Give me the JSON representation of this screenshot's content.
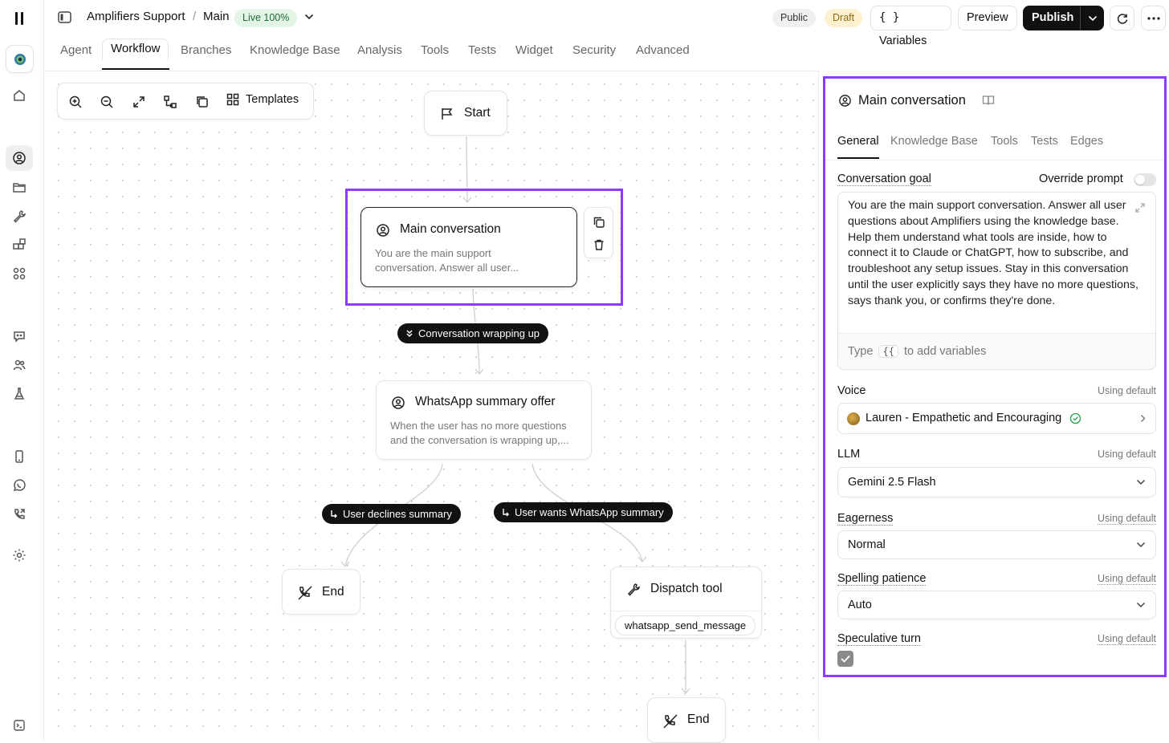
{
  "header": {
    "agent_name": "Amplifiers Support",
    "separator": "/",
    "branch": "Main",
    "live_badge": "Live 100%",
    "public_badge": "Public",
    "draft_badge": "Draft",
    "variables_label": "Variables",
    "preview_label": "Preview",
    "publish_label": "Publish"
  },
  "tabs": [
    "Agent",
    "Workflow",
    "Branches",
    "Knowledge Base",
    "Analysis",
    "Tools",
    "Tests",
    "Widget",
    "Security",
    "Advanced"
  ],
  "active_tab": "Workflow",
  "toolbar": {
    "templates_label": "Templates"
  },
  "nodes": {
    "start": {
      "title": "Start"
    },
    "main": {
      "title": "Main conversation",
      "desc_line1": "You are the main support",
      "desc_line2": "conversation. Answer all user..."
    },
    "whatsapp": {
      "title": "WhatsApp summary offer",
      "desc_line1": "When the user has no more questions",
      "desc_line2": "and the conversation is wrapping up,..."
    },
    "end1": {
      "title": "End"
    },
    "dispatch": {
      "title": "Dispatch tool",
      "tool": "whatsapp_send_message"
    },
    "end2": {
      "title": "End"
    }
  },
  "edges": {
    "wrapping": "Conversation wrapping up",
    "declines": "User declines summary",
    "wants": "User wants WhatsApp summary"
  },
  "panel": {
    "title": "Main conversation",
    "tabs": [
      "General",
      "Knowledge Base",
      "Tools",
      "Tests",
      "Edges"
    ],
    "active_tab": "General",
    "goal_label": "Conversation goal",
    "override_label": "Override prompt",
    "goal_text": "You are the main support conversation. Answer all user questions about Amplifiers using the knowledge base. Help them understand what tools are inside, how to connect it to Claude or ChatGPT, how to subscribe, and troubleshoot any setup issues. Stay in this conversation until the user explicitly says they have no more questions, says thank you, or confirms they're done.",
    "var_hint_prefix": "Type",
    "var_hint_chip": "{{",
    "var_hint_suffix": "to add variables",
    "voice_label": "Voice",
    "voice_value": "Lauren - Empathetic and Encouraging",
    "llm_label": "LLM",
    "llm_value": "Gemini 2.5 Flash",
    "eagerness_label": "Eagerness",
    "eagerness_value": "Normal",
    "spelling_label": "Spelling patience",
    "spelling_value": "Auto",
    "speculative_label": "Speculative turn",
    "using_default": "Using default",
    "speculative_checked": true
  },
  "colors": {
    "selection": "#8b3dff",
    "live_bg": "#e2f5e7",
    "draft_bg": "#fdf1cf",
    "accent_dark": "#111111"
  }
}
